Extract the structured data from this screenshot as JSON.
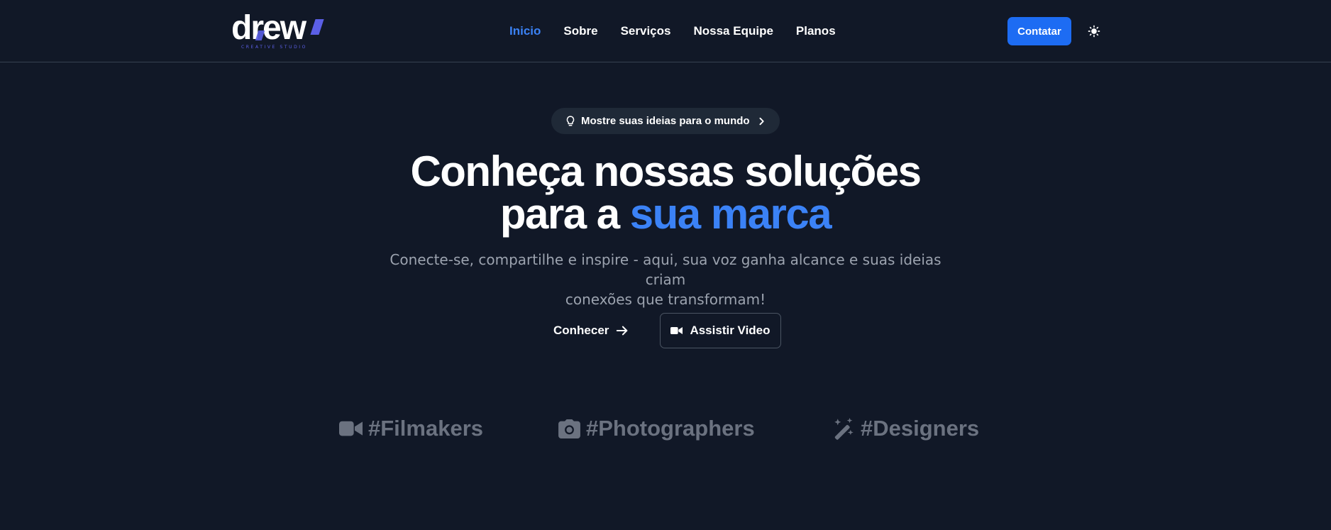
{
  "logo": {
    "word": "drew",
    "tagline": "CREATIVE STUDIO"
  },
  "nav": {
    "items": [
      {
        "label": "Inicio",
        "active": true
      },
      {
        "label": "Sobre",
        "active": false
      },
      {
        "label": "Serviços",
        "active": false
      },
      {
        "label": "Nossa Equipe",
        "active": false
      },
      {
        "label": "Planos",
        "active": false
      }
    ]
  },
  "header": {
    "contact_label": "Contatar",
    "theme_icon": "sun-icon"
  },
  "hero": {
    "pill": {
      "icon": "lightbulb-icon",
      "text": "Mostre suas ideias para o mundo",
      "chevron": "chevron-right-icon"
    },
    "title_line1": "Conheça nossas soluções",
    "title_line2_plain": "para a",
    "title_line2_accent": "sua marca",
    "subtitle_line1": "Conecte-se, compartilhe e inspire - aqui, sua voz ganha alcance e suas ideias criam",
    "subtitle_line2": "conexões que transformam!",
    "primary_cta": "Conhecer",
    "secondary_cta": "Assistir Video"
  },
  "tags": [
    {
      "icon": "video-camera-icon",
      "label": "#Filmakers"
    },
    {
      "icon": "camera-icon",
      "label": "#Photographers"
    },
    {
      "icon": "magic-wand-icon",
      "label": "#Designers"
    }
  ],
  "colors": {
    "background": "#111827",
    "accent": "#3b82f6",
    "button": "#1d6cf3",
    "muted": "#9ca3af",
    "tag": "#6b7280",
    "logo_accent": "#5b5fe6"
  }
}
